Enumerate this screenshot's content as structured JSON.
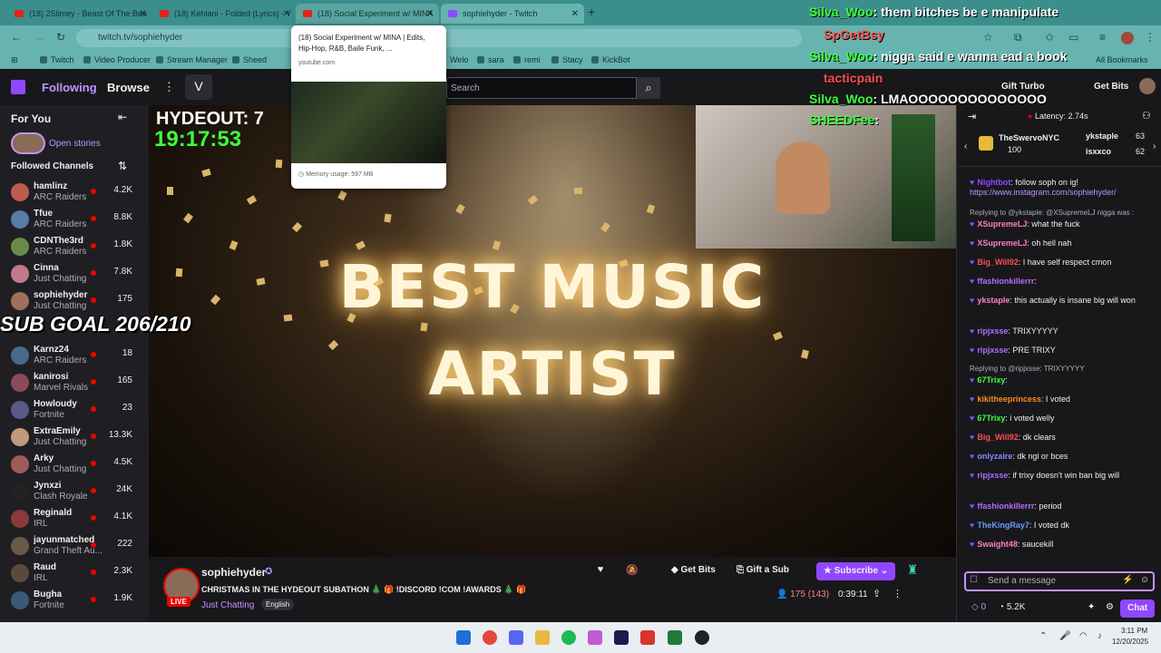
{
  "tabs": [
    {
      "title": "(18) 2Slimey - Beast Of The Bea",
      "kind": "yt"
    },
    {
      "title": "(18) Kehlani - Folded (Lyrics) - Y",
      "kind": "yt"
    },
    {
      "title": "(18) Social Experiment w/ MINA",
      "kind": "yt"
    },
    {
      "title": "sophiehyder - Twitch",
      "kind": "tw"
    }
  ],
  "new_tab": "+",
  "url": "twitch.tv/sophiehyder",
  "bookmarks": [
    "Twitch",
    "Video Producer",
    "Stream Manager",
    "Sheed",
    "Welo",
    "sara",
    "remi",
    "Stacy",
    "KickBot",
    "All Bookmarks"
  ],
  "preview": {
    "title": "(18) Social Experiment w/ MINA | Edits, Hip-Hop, R&B, Baile Funk, ...",
    "site": "youtube.com",
    "memory": "Memory usage: 597 MB"
  },
  "nav": {
    "following": "Following",
    "browse": "Browse",
    "search_placeholder": "Search",
    "gift_turbo": "Gift Turbo",
    "get_bits": "Get Bits"
  },
  "sidebar": {
    "for_you": "For You",
    "open_stories": "Open stories",
    "followed": "Followed Channels",
    "channels": [
      {
        "name": "hamlinz",
        "game": "ARC Raiders",
        "viewers": "4.2K"
      },
      {
        "name": "Tfue",
        "game": "ARC Raiders",
        "viewers": "8.8K"
      },
      {
        "name": "CDNThe3rd",
        "game": "ARC Raiders",
        "viewers": "1.8K"
      },
      {
        "name": "Cinna",
        "game": "Just Chatting",
        "viewers": "7.8K"
      },
      {
        "name": "sophiehyder",
        "game": "Just Chatting",
        "viewers": "175"
      },
      {
        "name": "",
        "game": "",
        "viewers": ""
      },
      {
        "name": "Karnz24",
        "game": "ARC Raiders",
        "viewers": "18"
      },
      {
        "name": "kanirosi",
        "game": "Marvel Rivals",
        "viewers": "165"
      },
      {
        "name": "Howloudy",
        "game": "Fortnite",
        "viewers": "23"
      },
      {
        "name": "ExtraEmily",
        "game": "Just Chatting",
        "viewers": "13.3K"
      },
      {
        "name": "Arky",
        "game": "Just Chatting",
        "viewers": "4.5K"
      },
      {
        "name": "Jynxzi",
        "game": "Clash Royale",
        "viewers": "24K"
      },
      {
        "name": "Reginald",
        "game": "IRL",
        "viewers": "4.1K"
      },
      {
        "name": "jayunmatched",
        "game": "Grand Theft Au...",
        "viewers": "222"
      },
      {
        "name": "Raud",
        "game": "IRL",
        "viewers": "2.3K"
      },
      {
        "name": "Bugha",
        "game": "Fortnite",
        "viewers": "1.9K"
      }
    ]
  },
  "overlay": {
    "hydeout": "HYDEOUT: 7",
    "timer": "19:17:53",
    "sub_goal": "SUB GOAL 206/210",
    "award_line1": "BEST MUSIC",
    "award_line2": "ARTIST"
  },
  "overlay_chat": [
    {
      "user": "Silva_Woo",
      "text": ": them bitches be e",
      "tail": "manipulate",
      "color": "#3dff3d"
    },
    {
      "user": "SpGetBsy",
      "text": "",
      "tail": "",
      "color": "#ff3d3d"
    },
    {
      "user": "Silva_Woo",
      "text": ": nigga said e wanna ead a book",
      "tail": "",
      "color": "#3dff3d"
    },
    {
      "user": "tacticpain",
      "text": "",
      "tail": "",
      "color": "#ff3d3d"
    },
    {
      "user": "Silva_Woo",
      "text": ": LMAOOOOOOOOOOOOOO",
      "tail": "",
      "color": "#3dff3d"
    },
    {
      "user": "SHEEDFee",
      "text": ":",
      "tail": "",
      "color": "#3dff3d"
    }
  ],
  "stream": {
    "channel": "sophiehyder",
    "title": "CHRISTMAS IN THE HYDEOUT SUBATHON 🎄 🎁 !DISCORD !COM !AWARDS 🎄 🎁",
    "category": "Just Chatting",
    "language": "English",
    "live": "LIVE",
    "viewers": "175 (143)",
    "uptime": "0:39:11",
    "get_bits": "Get Bits",
    "gift_sub": "Gift a Sub",
    "subscribe": "Subscribe"
  },
  "chat": {
    "latency": "Latency: 2.74s",
    "top_gifter": {
      "name": "TheSwervoNYC",
      "count": "100"
    },
    "leaders": [
      {
        "name": "ykstaple",
        "count": "63"
      },
      {
        "name": "isxxco",
        "count": "62"
      }
    ],
    "messages": [
      {
        "user": "Nightbot",
        "text": ": follow soph on ig!",
        "link": "https://www.instagram.com/sophiehyder/",
        "color": "#9147ff",
        "reply": ""
      },
      {
        "user": "XSupremeLJ",
        "text": ": what the fuck",
        "color": "#ff7fbf",
        "reply": "Replying to @ykstaple: @XSupremeLJ nigga was :"
      },
      {
        "user": "XSupremeLJ",
        "text": ": oh hell nah",
        "color": "#ff7fbf",
        "reply": ""
      },
      {
        "user": "Big_Will92",
        "text": ": I have self respect cmon",
        "color": "#ff4d4d",
        "reply": ""
      },
      {
        "user": "ffashionkillerrr",
        "text": ":",
        "color": "#b36bff",
        "reply": ""
      },
      {
        "user": "ykstaple",
        "text": ": this actually is insane big will won",
        "color": "#ff7fbf",
        "reply": ""
      },
      {
        "user": "ripjxsse",
        "text": ": TRIXYYYYY",
        "color": "#b36bff",
        "reply": ""
      },
      {
        "user": "ripjxsse",
        "text": ": PRE TRIXY",
        "color": "#b36bff",
        "reply": ""
      },
      {
        "user": "67Trixy",
        "text": ":",
        "color": "#3dff3d",
        "reply": "Replying to @ripjxsse: TRIXYYYYY"
      },
      {
        "user": "kikitheeprincess",
        "text": ": I voted",
        "color": "#ff8c1a",
        "reply": ""
      },
      {
        "user": "67Trixy",
        "text": ": i voted welly",
        "color": "#3dff3d",
        "reply": ""
      },
      {
        "user": "Big_Will92",
        "text": ": dk clears",
        "color": "#ff4d4d",
        "reply": ""
      },
      {
        "user": "onlyzaire",
        "text": ": dk ngl or bces",
        "color": "#8a8aff",
        "reply": ""
      },
      {
        "user": "ripjxsse",
        "text": ": if trixy doesn't win ban big will",
        "color": "#b36bff",
        "reply": ""
      },
      {
        "user": "ffashionkillerrr",
        "text": ": period",
        "color": "#b36bff",
        "reply": ""
      },
      {
        "user": "TheKingRay7",
        "text": ": I voted dk",
        "color": "#6b9bff",
        "reply": ""
      },
      {
        "user": "Swaight48",
        "text": ": saucekill",
        "color": "#ff7fbf",
        "reply": ""
      }
    ],
    "placeholder": "Send a message",
    "points": "0",
    "channel_points": "5.2K",
    "chat_button": "Chat"
  },
  "taskbar": {
    "time": "3:11 PM",
    "date": "12/20/2025"
  },
  "colors": {
    "accent": "#9147ff",
    "chrome": "#66b3b0",
    "live": "#eb0400"
  }
}
